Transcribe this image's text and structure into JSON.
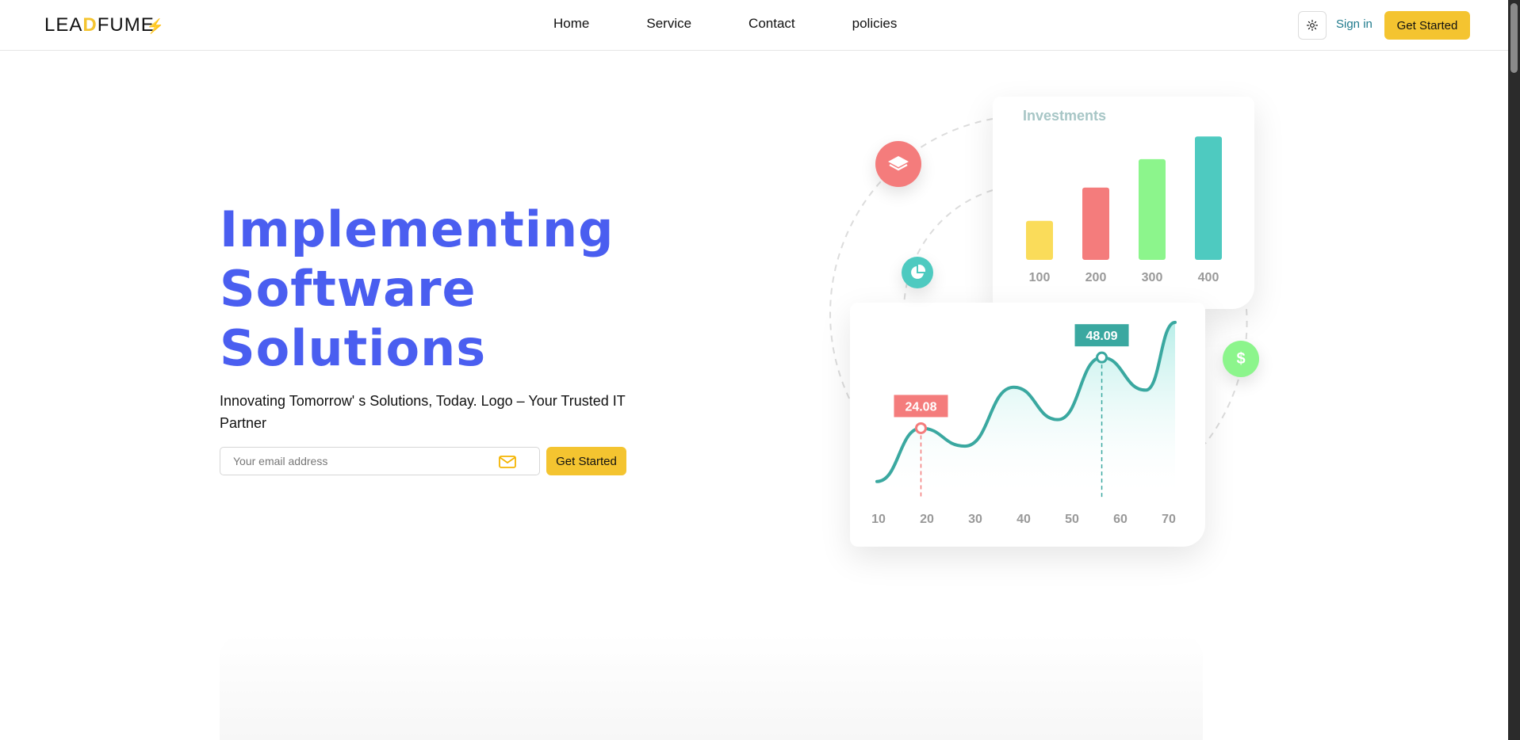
{
  "header": {
    "logo": {
      "part1": "LEA",
      "part2": "D",
      "part3": "FUME",
      "bolt": "⚡"
    },
    "nav": [
      {
        "label": "Home"
      },
      {
        "label": "Service"
      },
      {
        "label": "Contact"
      },
      {
        "label": "policies"
      }
    ],
    "theme_icon": "sun-icon",
    "signin_label": "Sign in",
    "cta_label": "Get Started"
  },
  "hero": {
    "title_lines": [
      "Implementing",
      "Software",
      "Solutions"
    ],
    "subtitle": "Innovating Tomorrow' s Solutions, Today. Logo – Your Trusted IT Partner",
    "email_placeholder": "Your email address",
    "cta_label": "Get Started",
    "mail_icon": "mail-icon"
  },
  "illustration": {
    "icons": [
      "layers-icon",
      "pie-chart-icon",
      "dollar-icon"
    ],
    "dollar_glyph": "$"
  },
  "colors": {
    "accent": "#4a5ef0",
    "cta": "#f4c430",
    "signin": "#1f7a8c",
    "teal": "#3aa8a0",
    "red": "#f47c7c",
    "green": "#8cf58c",
    "yellow": "#fadc5a"
  },
  "chart_data": [
    {
      "type": "bar",
      "title": "Investments",
      "categories": [
        "100",
        "200",
        "300",
        "400"
      ],
      "values": [
        48,
        89,
        124,
        152
      ],
      "colors": [
        "#fadc5a",
        "#f47c7c",
        "#8cf58c",
        "#4ecac0"
      ],
      "ylim": [
        0,
        160
      ]
    },
    {
      "type": "area",
      "x_ticks": [
        "10",
        "20",
        "30",
        "40",
        "50",
        "60",
        "70"
      ],
      "x": [
        10,
        19,
        28,
        38,
        47,
        56,
        65,
        71
      ],
      "y": [
        6,
        24.08,
        18,
        38,
        27,
        48.09,
        37,
        60
      ],
      "xlim": [
        10,
        71
      ],
      "ylim": [
        0,
        64
      ],
      "annotations": [
        {
          "label": "24.08",
          "x": 19,
          "y": 24.08,
          "color": "#f47c7c"
        },
        {
          "label": "48.09",
          "x": 56,
          "y": 48.09,
          "color": "#3aa8a0"
        }
      ]
    }
  ]
}
